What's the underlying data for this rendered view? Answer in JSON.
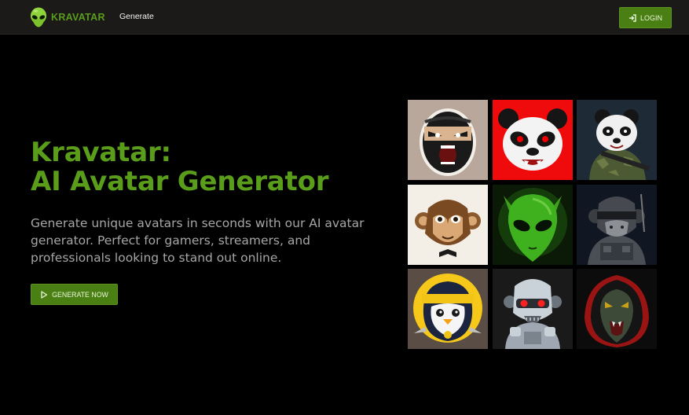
{
  "navbar": {
    "brand": "KRAVATAR",
    "nav_link": "Generate",
    "login_label": "LOGIN",
    "colors": {
      "background": "#1c1a19",
      "brand": "#5a9d1b",
      "button": "#4a7f14"
    }
  },
  "hero": {
    "title_line1": "Kravatar:",
    "title_line2": "AI Avatar Generator",
    "description": "Generate unique avatars in seconds with our AI avatar generator. Perfect for gamers, streamers, and professionals looking to stand out online.",
    "cta_label": "GENERATE NOW",
    "colors": {
      "title": "#5a9d1b",
      "text": "#a6a6a6",
      "button": "#4a7f14"
    }
  },
  "avatars": [
    {
      "icon": "ninja-avatar",
      "background": "#b8a79a"
    },
    {
      "icon": "panda-avatar",
      "background": "#ef0b0b"
    },
    {
      "icon": "soldier-panda-avatar",
      "background": "#1e2a36"
    },
    {
      "icon": "monkey-avatar",
      "background": "#f4efe6"
    },
    {
      "icon": "alien-avatar",
      "background": "#0b1a06"
    },
    {
      "icon": "soldier-monkey-avatar",
      "background": "#101722"
    },
    {
      "icon": "penguin-avatar",
      "background": "#5a4d45"
    },
    {
      "icon": "robot-avatar",
      "background": "#1a1a1a"
    },
    {
      "icon": "hooded-reptile-avatar",
      "background": "#0c0c0c"
    }
  ]
}
